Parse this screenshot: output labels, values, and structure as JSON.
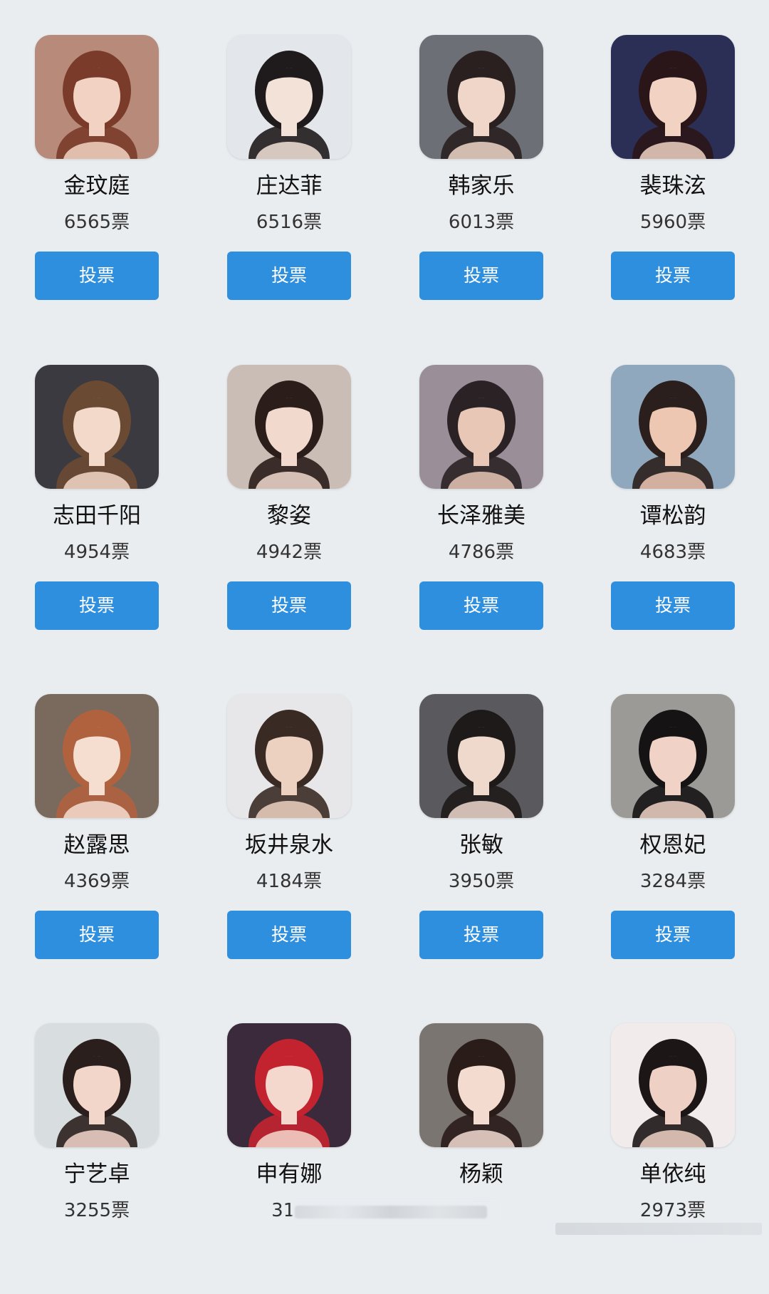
{
  "vote_button_label": "投票",
  "accent_color": "#2f8fdf",
  "candidates": [
    {
      "name": "金玟庭",
      "votes": "6565票",
      "avatar": {
        "bg": "#b78a7a",
        "skin": "#f2d2c2",
        "hair": "#7a3b2a"
      }
    },
    {
      "name": "庄达菲",
      "votes": "6516票",
      "avatar": {
        "bg": "#e3e6ea",
        "skin": "#f3e2d8",
        "hair": "#1f1b1d"
      }
    },
    {
      "name": "韩家乐",
      "votes": "6013票",
      "avatar": {
        "bg": "#6c7076",
        "skin": "#efd6c8",
        "hair": "#2a2020"
      }
    },
    {
      "name": "裴珠泫",
      "votes": "5960票",
      "avatar": {
        "bg": "#2b2f55",
        "skin": "#f1d2c3",
        "hair": "#2a1618"
      }
    },
    {
      "name": "志田千阳",
      "votes": "4954票",
      "avatar": {
        "bg": "#3a3a40",
        "skin": "#f3d9c9",
        "hair": "#6b4a34"
      }
    },
    {
      "name": "黎姿",
      "votes": "4942票",
      "avatar": {
        "bg": "#c9bdb6",
        "skin": "#f1d9cd",
        "hair": "#2a1d1a"
      }
    },
    {
      "name": "长泽雅美",
      "votes": "4786票",
      "avatar": {
        "bg": "#9a8e99",
        "skin": "#e8c7b6",
        "hair": "#2b2226"
      }
    },
    {
      "name": "谭松韵",
      "votes": "4683票",
      "avatar": {
        "bg": "#8fa8bd",
        "skin": "#eec7b3",
        "hair": "#2a1f1c"
      }
    },
    {
      "name": "赵露思",
      "votes": "4369票",
      "avatar": {
        "bg": "#7a6a5e",
        "skin": "#f5ddd0",
        "hair": "#b0623f"
      }
    },
    {
      "name": "坂井泉水",
      "votes": "4184票",
      "avatar": {
        "bg": "#e7e7ea",
        "skin": "#ecd1c0",
        "hair": "#3a2a24"
      }
    },
    {
      "name": "张敏",
      "votes": "3950票",
      "avatar": {
        "bg": "#5a5a5e",
        "skin": "#efd8cc",
        "hair": "#1e1a1a"
      }
    },
    {
      "name": "权恩妃",
      "votes": "3284票",
      "avatar": {
        "bg": "#9b9a96",
        "skin": "#f0d3c6",
        "hair": "#161314"
      }
    },
    {
      "name": "宁艺卓",
      "votes": "3255票",
      "avatar": {
        "bg": "#d8dde0",
        "skin": "#f2d6ca",
        "hair": "#2b1f1d"
      }
    },
    {
      "name": "申有娜",
      "votes": "314",
      "avatar": {
        "bg": "#3b2a3c",
        "skin": "#f4d8cd",
        "hair": "#c3232f"
      }
    },
    {
      "name": "杨颖",
      "votes": "票",
      "avatar": {
        "bg": "#7a7570",
        "skin": "#f3dbd0",
        "hair": "#2a1c19"
      }
    },
    {
      "name": "单依纯",
      "votes": "2973票",
      "avatar": {
        "bg": "#f1eceb",
        "skin": "#eed1c4",
        "hair": "#1c1616"
      }
    }
  ]
}
